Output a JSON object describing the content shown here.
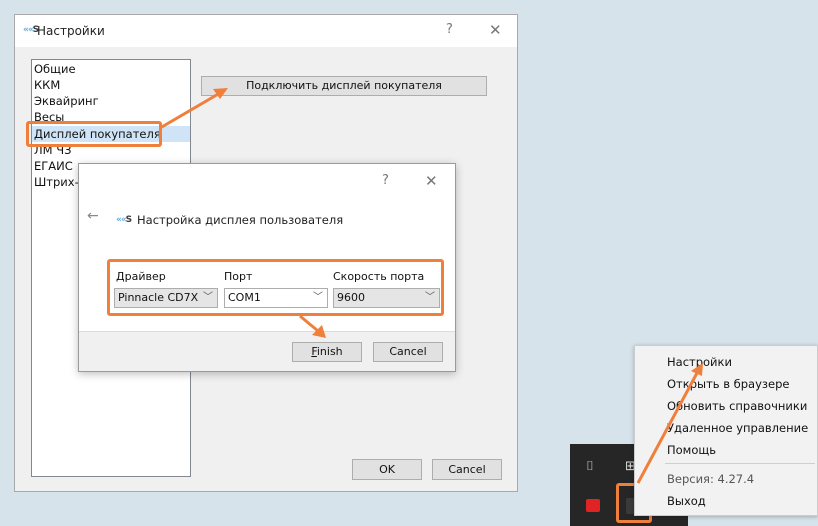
{
  "main_window": {
    "title": "Настройки",
    "help_glyph": "?",
    "close_glyph": "✕",
    "logo_text": "S",
    "list_items": [
      "Общие",
      "ККМ",
      "Эквайринг",
      "Весы",
      "Дисплей покупателя",
      "ЛМ ЧЗ",
      "ЕГАИС",
      "Штрих-М"
    ],
    "selected_item": "Дисплей покупателя",
    "connect_button": "Подключить дисплей покупателя",
    "ok_button": "OK",
    "cancel_button": "Cancel"
  },
  "dialog": {
    "help_glyph": "?",
    "close_glyph": "✕",
    "back_glyph": "←",
    "logo_text": "S",
    "heading": "Настройка дисплея пользователя",
    "driver_label": "Драйвер",
    "driver_value": "Pinnacle CD7X",
    "port_label": "Порт",
    "port_value": "COM1",
    "speed_label": "Скорость порта",
    "speed_value": "9600",
    "finish_button_rest": "inish",
    "finish_button_mnemonic": "F",
    "cancel_button": "Cancel"
  },
  "tray_menu": {
    "items": [
      "Настройки",
      "Открыть в браузере",
      "Обновить справочники",
      "Удаленное управление",
      "Помощь"
    ],
    "version": "Версия: 4.27.4",
    "exit": "Выход"
  },
  "colors": {
    "highlight": "#f07f3c",
    "selection": "#cfe4f7",
    "taskbar": "#262626"
  },
  "icons": [
    "logo-icon",
    "help-icon",
    "close-icon",
    "back-arrow-icon",
    "chevron-down-icon",
    "usb-icon",
    "network-icon",
    "app-tray-icon"
  ]
}
